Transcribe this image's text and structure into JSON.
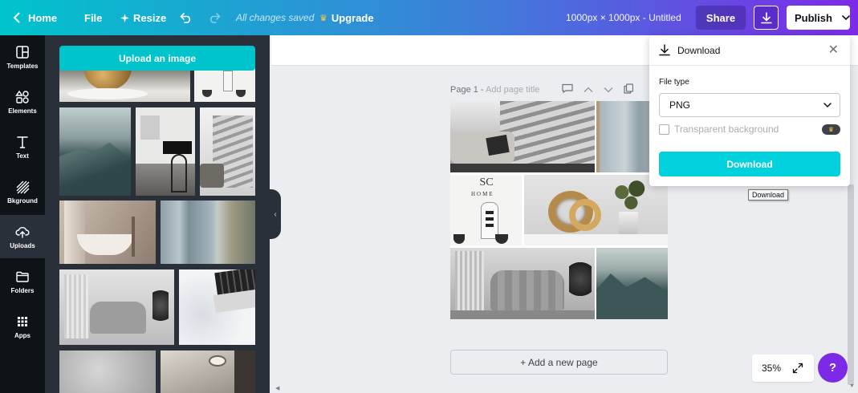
{
  "topbar": {
    "home_label": "Home",
    "file_label": "File",
    "resize_label": "Resize",
    "saved_status": "All changes saved",
    "upgrade_label": "Upgrade",
    "document_title": "1000px × 1000px - Untitled",
    "share_label": "Share",
    "publish_label": "Publish"
  },
  "leftnav": {
    "items": [
      {
        "label": "Templates",
        "icon": "templates-icon"
      },
      {
        "label": "Elements",
        "icon": "elements-icon"
      },
      {
        "label": "Text",
        "icon": "text-icon"
      },
      {
        "label": "Bkground",
        "icon": "background-icon"
      },
      {
        "label": "Uploads",
        "icon": "upload-cloud-icon",
        "active": true
      },
      {
        "label": "Folders",
        "icon": "folder-icon"
      },
      {
        "label": "Apps",
        "icon": "apps-grid-icon"
      }
    ]
  },
  "panel": {
    "upload_button_label": "Upload an image"
  },
  "canvas": {
    "page_label": "Page 1 - ",
    "add_page_title_placeholder": "Add page title",
    "add_page_label": "+ Add a new page",
    "zoom_level": "35%"
  },
  "download_panel": {
    "title": "Download",
    "file_type_label": "File type",
    "file_type_value": "PNG",
    "transparent_label": "Transparent background",
    "download_button_label": "Download",
    "tooltip": "Download"
  },
  "help_label": "?",
  "colors": {
    "accent": "#00c4cc",
    "purple": "#7d2ae8",
    "nav_bg": "#0e1318",
    "panel_bg": "#293039"
  }
}
